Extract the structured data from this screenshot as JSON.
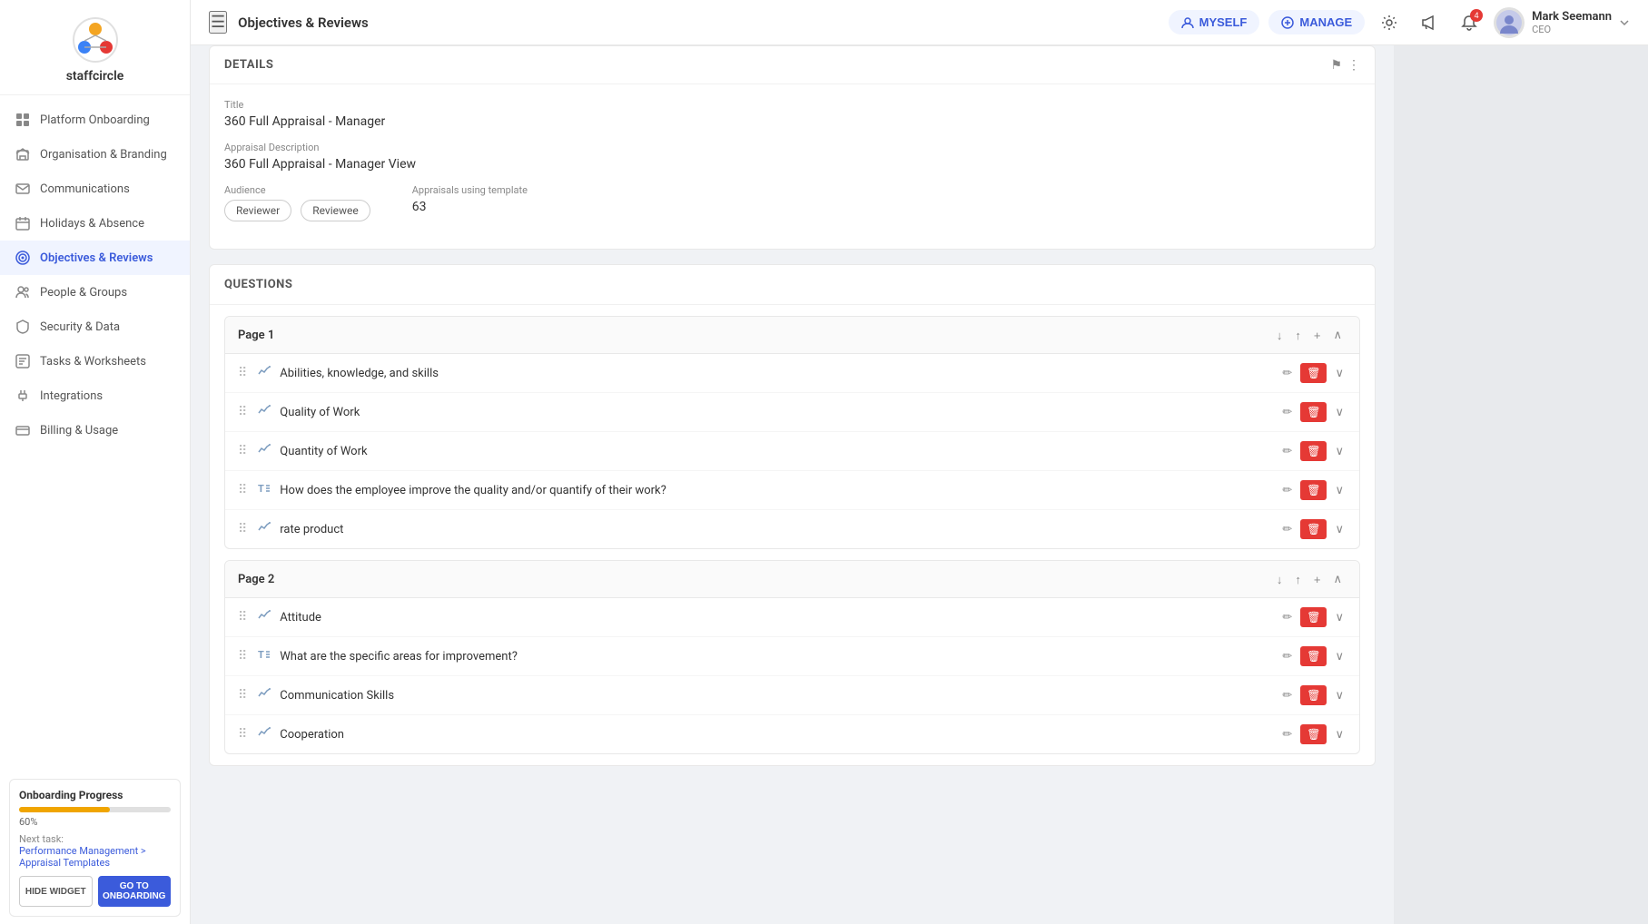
{
  "sidebar": {
    "logo_text": "staffcircle",
    "nav_items": [
      {
        "id": "platform-onboarding",
        "label": "Platform Onboarding",
        "icon": "grid"
      },
      {
        "id": "organisation-branding",
        "label": "Organisation & Branding",
        "icon": "building"
      },
      {
        "id": "communications",
        "label": "Communications",
        "icon": "mail"
      },
      {
        "id": "holidays-absence",
        "label": "Holidays & Absence",
        "icon": "calendar"
      },
      {
        "id": "objectives-reviews",
        "label": "Objectives & Reviews",
        "icon": "target",
        "active": true
      },
      {
        "id": "people-groups",
        "label": "People & Groups",
        "icon": "people"
      },
      {
        "id": "security-data",
        "label": "Security & Data",
        "icon": "shield"
      },
      {
        "id": "tasks-worksheets",
        "label": "Tasks & Worksheets",
        "icon": "tasks"
      },
      {
        "id": "integrations",
        "label": "Integrations",
        "icon": "plug"
      },
      {
        "id": "billing-usage",
        "label": "Billing & Usage",
        "icon": "card"
      }
    ],
    "onboarding": {
      "title": "Onboarding Progress",
      "progress_percent": 60,
      "progress_label": "60%",
      "next_task_label": "Next task:",
      "next_task_link": "Performance Management > Appraisal Templates",
      "hide_btn": "HIDE WIDGET",
      "go_btn": "GO TO ONBOARDING"
    }
  },
  "topbar": {
    "menu_icon": "☰",
    "title": "Objectives & Reviews",
    "myself_label": "MYSELF",
    "manage_label": "MANAGE",
    "notification_count": "4",
    "user_name": "Mark Seemann",
    "user_role": "CEO"
  },
  "details": {
    "section_label": "DETAILS",
    "title_label": "Title",
    "title_value": "360 Full Appraisal - Manager",
    "description_label": "Appraisal Description",
    "description_value": "360 Full Appraisal - Manager View",
    "audience_label": "Audience",
    "audience_tags": [
      "Reviewer",
      "Reviewee"
    ],
    "appraisals_label": "Appraisals using template",
    "appraisals_count": "63"
  },
  "questions": {
    "section_label": "QUESTIONS",
    "pages": [
      {
        "id": "page1",
        "label": "Page 1",
        "items": [
          {
            "id": "q1",
            "text": "Abilities, knowledge, and skills",
            "type": "trend"
          },
          {
            "id": "q2",
            "text": "Quality of Work",
            "type": "trend"
          },
          {
            "id": "q3",
            "text": "Quantity of Work",
            "type": "trend"
          },
          {
            "id": "q4",
            "text": "How does the employee improve the quality and/or quantify of their work?",
            "type": "text"
          },
          {
            "id": "q5",
            "text": "rate product",
            "type": "trend"
          }
        ]
      },
      {
        "id": "page2",
        "label": "Page 2",
        "items": [
          {
            "id": "q6",
            "text": "Attitude",
            "type": "trend"
          },
          {
            "id": "q7",
            "text": "What are the specific areas for improvement?",
            "type": "text"
          },
          {
            "id": "q8",
            "text": "Communication Skills",
            "type": "trend"
          },
          {
            "id": "q9",
            "text": "Cooperation",
            "type": "trend"
          }
        ]
      }
    ],
    "page_controls": {
      "down_icon": "↓",
      "up_icon": "↑",
      "add_icon": "+",
      "collapse_icon": "∧"
    }
  }
}
